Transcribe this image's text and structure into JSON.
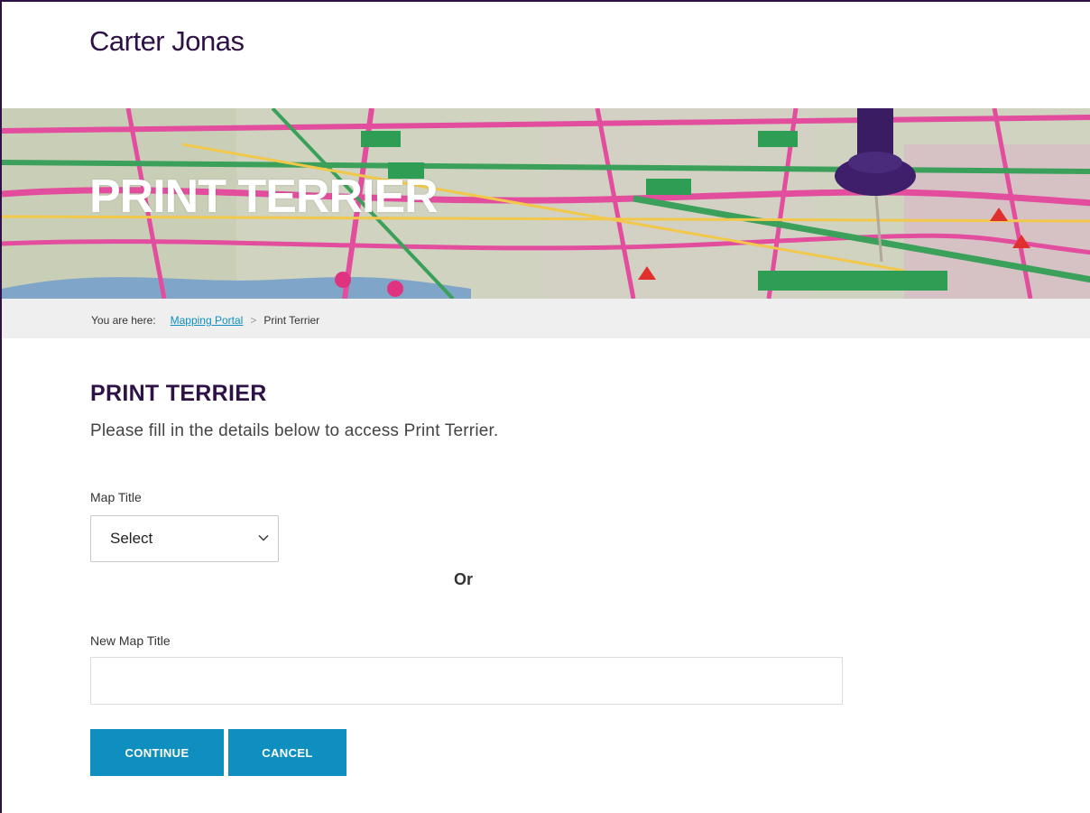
{
  "header": {
    "logo_text": "Carter Jonas"
  },
  "hero": {
    "title": "PRINT TERRIER"
  },
  "breadcrumb": {
    "prefix": "You are here:",
    "link": "Mapping Portal",
    "separator": ">",
    "current": "Print Terrier"
  },
  "form": {
    "title": "PRINT TERRIER",
    "intro": "Please fill in the details below to access Print Terrier.",
    "map_title_label": "Map Title",
    "map_title_selected": "Select",
    "or_text": "Or",
    "new_map_title_label": "New Map Title",
    "new_map_title_value": "",
    "continue_label": "CONTINUE",
    "cancel_label": "CANCEL"
  },
  "colors": {
    "brand_purple": "#2e1245",
    "button_blue": "#0f8fbf",
    "breadcrumb_bg": "#efefef"
  },
  "icons": {
    "select_chevron": "chevron-down-icon",
    "breadcrumb_separator": "chevron-right-icon"
  }
}
